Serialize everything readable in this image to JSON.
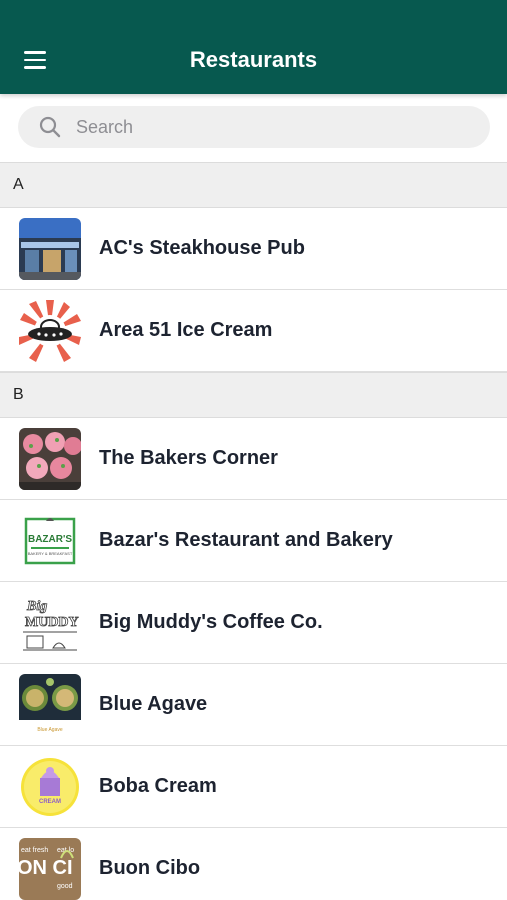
{
  "header": {
    "title": "Restaurants",
    "menu_icon": "hamburger-menu-icon"
  },
  "search": {
    "placeholder": "Search",
    "value": "",
    "icon": "search-icon"
  },
  "sections": [
    {
      "letter": "A",
      "items": [
        {
          "name": "AC's Steakhouse Pub",
          "thumb": "steakhouse-photo"
        },
        {
          "name": "Area 51 Ice Cream",
          "thumb": "ufo-logo"
        }
      ]
    },
    {
      "letter": "B",
      "items": [
        {
          "name": "The Bakers Corner",
          "thumb": "cupcakes-photo"
        },
        {
          "name": "Bazar's Restaurant and Bakery",
          "thumb": "bazars-logo"
        },
        {
          "name": "Big Muddy's Coffee Co.",
          "thumb": "big-muddy-logo"
        },
        {
          "name": "Blue Agave",
          "thumb": "blue-agave-logo"
        },
        {
          "name": "Boba Cream",
          "thumb": "boba-cream-logo"
        },
        {
          "name": "Buon Cibo",
          "thumb": "buon-cibo-logo"
        }
      ]
    }
  ],
  "colors": {
    "app_bar": "#07594f",
    "section_bg": "#efefef",
    "search_bg": "#efefef"
  }
}
